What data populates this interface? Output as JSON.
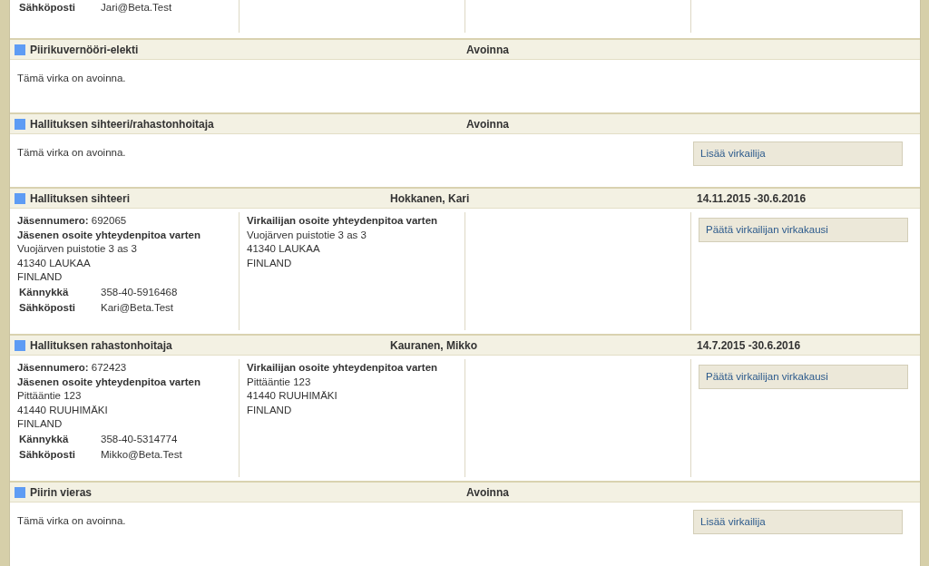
{
  "sections": [
    {
      "kind": "partial",
      "contacts": [
        {
          "label": "Sähköposti",
          "value": "Jari@Beta.Test"
        }
      ]
    },
    {
      "kind": "vacant",
      "title": "Piirikuvernööri-elekti",
      "status": "Avoinna",
      "note": "Tämä virka on avoinna."
    },
    {
      "kind": "vacant",
      "title": "Hallituksen sihteeri/rahastonhoitaja",
      "status": "Avoinna",
      "note": "Tämä virka on avoinna.",
      "action": "Lisää virkailija"
    },
    {
      "kind": "filled",
      "title": "Hallituksen sihteeri",
      "name": "Hokkanen, Kari",
      "term": "14.11.2015 -30.6.2016",
      "member_number_label": "Jäsennumero:",
      "member_number": "692065",
      "member_address_heading": "Jäsenen osoite yhteydenpitoa varten",
      "member_address": [
        "Vuojärven puistotie 3 as 3",
        "41340 LAUKAA",
        "FINLAND"
      ],
      "contacts": [
        {
          "label": "Kännykkä",
          "value": "358-40-5916468"
        },
        {
          "label": "Sähköposti",
          "value": "Kari@Beta.Test"
        }
      ],
      "officer_address_heading": "Virkailijan osoite yhteydenpitoa varten",
      "officer_address": [
        "Vuojärven puistotie 3 as 3",
        "41340 LAUKAA",
        "FINLAND"
      ],
      "action": "Päätä virkailijan virkakausi"
    },
    {
      "kind": "filled",
      "title": "Hallituksen rahastonhoitaja",
      "name": "Kauranen, Mikko",
      "term": "14.7.2015 -30.6.2016",
      "member_number_label": "Jäsennumero:",
      "member_number": "672423",
      "member_address_heading": "Jäsenen osoite yhteydenpitoa varten",
      "member_address": [
        "Pittääntie 123",
        "41440 RUUHIMÄKI",
        "FINLAND"
      ],
      "contacts": [
        {
          "label": "Kännykkä",
          "value": "358-40-5314774"
        },
        {
          "label": "Sähköposti",
          "value": "Mikko@Beta.Test"
        }
      ],
      "officer_address_heading": "Virkailijan osoite yhteydenpitoa varten",
      "officer_address": [
        "Pittääntie 123",
        "41440 RUUHIMÄKI",
        "FINLAND"
      ],
      "action": "Päätä virkailijan virkakausi"
    },
    {
      "kind": "vacant",
      "title": "Piirin vieras",
      "status": "Avoinna",
      "note": "Tämä virka on avoinna.",
      "action": "Lisää virkailija"
    }
  ]
}
